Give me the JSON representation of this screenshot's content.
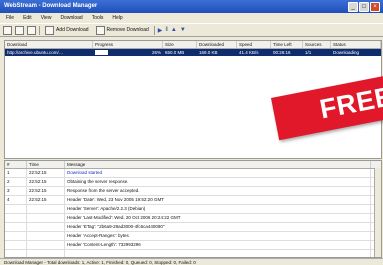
{
  "window": {
    "title": "WebStream - Download Manager"
  },
  "menu": [
    "File",
    "Edit",
    "View",
    "Download",
    "Tools",
    "Help"
  ],
  "toolbar": {
    "add_label": "Add Download",
    "remove_label": "Remove Download"
  },
  "downloads": {
    "columns": [
      "Download",
      "Progress",
      "Size",
      "Downloaded",
      "Speed",
      "Time Left",
      "Sources",
      "Status"
    ],
    "rows": [
      {
        "download": "http://archive.ubuntu.com/…",
        "progress": 0.26,
        "progress_text": "26%",
        "size": "650.0 MB",
        "downloaded": "169.0 KB",
        "speed": "41.4 KB/s",
        "time_left": "00:26:16",
        "sources": "1/1",
        "status": "Downloading"
      }
    ]
  },
  "banner": {
    "text": "FREE"
  },
  "log": {
    "columns": [
      "#",
      "Time",
      "Message"
    ],
    "rows": [
      {
        "num": "1",
        "time": "22:52:15",
        "msg": "Download started",
        "hl": true
      },
      {
        "num": "2",
        "time": "22:52:15",
        "msg": "Obtaining the server response.",
        "hl": false
      },
      {
        "num": "3",
        "time": "22:52:15",
        "msg": "Response from the server accepted.",
        "hl": false
      },
      {
        "num": "4",
        "time": "22:52:15",
        "msg": "Header 'Date': Wed, 23 Nov 2005 19:52:20 GMT",
        "hl": false
      },
      {
        "num": "",
        "time": "",
        "msg": "Header 'Server': Apache/2.2.3 (Debian)",
        "hl": false
      },
      {
        "num": "",
        "time": "",
        "msg": "Header 'Last-Modified': Wed, 20 Oct 2006 20:24:22 GMT",
        "hl": false
      },
      {
        "num": "",
        "time": "",
        "msg": "Header 'ETag': \"2b6a9-28ad3000-4fc6ca440090\"",
        "hl": false
      },
      {
        "num": "",
        "time": "",
        "msg": "Header 'Accept-Ranges': bytes",
        "hl": false
      },
      {
        "num": "",
        "time": "",
        "msg": "Header 'Content-Length': 732993296",
        "hl": false
      },
      {
        "num": "",
        "time": "",
        "msg": "",
        "hl": false
      }
    ]
  },
  "status": {
    "text": "Download Manager - Total downloads: 1, Active: 1, Finished: 0, Queued: 0, Stopped: 0, Failed: 0"
  }
}
